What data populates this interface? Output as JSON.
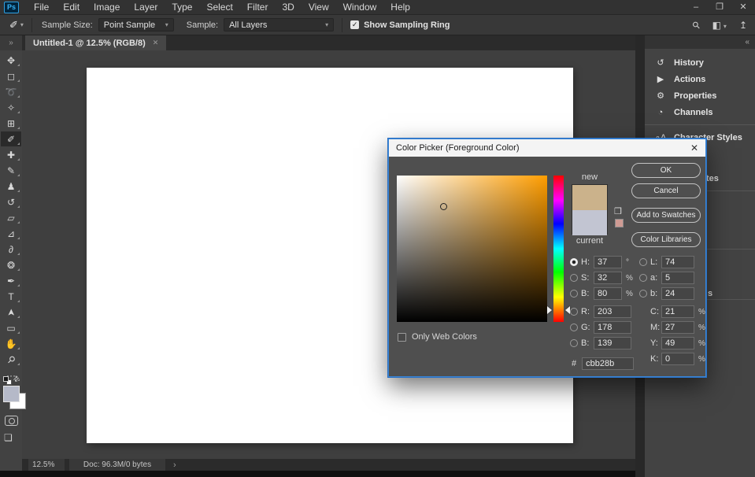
{
  "app": {
    "logo": "Ps"
  },
  "menubar": {
    "items": [
      "File",
      "Edit",
      "Image",
      "Layer",
      "Type",
      "Select",
      "Filter",
      "3D",
      "View",
      "Window",
      "Help"
    ]
  },
  "window_controls": {
    "minimize": "–",
    "restore": "❐",
    "close": "✕"
  },
  "icons": {
    "check": "✓",
    "chevron_down": "▾",
    "search": "⚲",
    "workspace": "◧",
    "share": "↥",
    "collapse_left": "«",
    "collapse_right": "»",
    "eyedropper": "✐",
    "swap_colors": "⇄",
    "screen_mode": "❏",
    "cube": "❒",
    "status_chevron": "›",
    "dialog_close": "✕"
  },
  "options_bar": {
    "sample_size_label": "Sample Size:",
    "sample_size_value": "Point Sample",
    "sample_label": "Sample:",
    "sample_value": "All Layers",
    "show_sampling_ring_label": "Show Sampling Ring",
    "show_sampling_ring_checked": true
  },
  "tab": {
    "title": "Untitled-1 @ 12.5% (RGB/8)",
    "close": "✕"
  },
  "toolbar": {
    "foreground_color": "#b5b9c8",
    "background_color": "#ffffff",
    "tools": [
      {
        "name": "move-tool",
        "glyph": "✥"
      },
      {
        "name": "rectangular-marquee-tool",
        "glyph": "◻"
      },
      {
        "name": "lasso-tool",
        "glyph": "➰"
      },
      {
        "name": "quick-selection-tool",
        "glyph": "✧"
      },
      {
        "name": "crop-tool",
        "glyph": "⊞"
      },
      {
        "name": "eyedropper-tool",
        "glyph": "✐",
        "active": true
      },
      {
        "name": "spot-healing-brush-tool",
        "glyph": "✚"
      },
      {
        "name": "brush-tool",
        "glyph": "✎"
      },
      {
        "name": "clone-stamp-tool",
        "glyph": "♟"
      },
      {
        "name": "history-brush-tool",
        "glyph": "↺"
      },
      {
        "name": "eraser-tool",
        "glyph": "▱"
      },
      {
        "name": "paint-bucket-tool",
        "glyph": "⊿"
      },
      {
        "name": "smudge-tool",
        "glyph": "∂"
      },
      {
        "name": "dodge-tool",
        "glyph": "❂"
      },
      {
        "name": "pen-tool",
        "glyph": "✒"
      },
      {
        "name": "type-tool",
        "glyph": "T"
      },
      {
        "name": "path-selection-tool",
        "glyph": "➤"
      },
      {
        "name": "rectangle-tool",
        "glyph": "▭"
      },
      {
        "name": "hand-tool",
        "glyph": "✋"
      },
      {
        "name": "zoom-tool",
        "glyph": "⚲"
      },
      {
        "name": "more-tools",
        "glyph": "···"
      }
    ]
  },
  "panels": {
    "items": [
      {
        "name": "history",
        "label": "History",
        "glyph": "↺"
      },
      {
        "name": "actions",
        "label": "Actions",
        "glyph": "▶"
      },
      {
        "name": "properties",
        "label": "Properties",
        "glyph": "⚙"
      },
      {
        "name": "channels",
        "label": "Channels",
        "glyph": "◔"
      },
      {
        "name": "character-styles",
        "label": "Character Styles",
        "glyph": "∘A",
        "divider_before": true
      }
    ],
    "fragments": [
      "tes",
      "s"
    ]
  },
  "dialog": {
    "title": "Color Picker (Foreground Color)",
    "new_label": "new",
    "current_label": "current",
    "new_color": "#cbb28b",
    "current_color": "#c2c5d2",
    "warning_swatch_color": "#cf9b94",
    "hue_deg": 37,
    "buttons": [
      "OK",
      "Cancel",
      "Add to Swatches",
      "Color Libraries"
    ],
    "left_fields": [
      {
        "key": "h",
        "label": "H:",
        "value": "37",
        "unit": "°",
        "radio": true,
        "selected": true
      },
      {
        "key": "s",
        "label": "S:",
        "value": "32",
        "unit": "%",
        "radio": true
      },
      {
        "key": "b",
        "label": "B:",
        "value": "80",
        "unit": "%",
        "radio": true
      },
      {
        "key": "r",
        "label": "R:",
        "value": "203",
        "radio": true,
        "gap_before": true
      },
      {
        "key": "g",
        "label": "G:",
        "value": "178",
        "radio": true
      },
      {
        "key": "b2",
        "label": "B:",
        "value": "139",
        "radio": true
      }
    ],
    "right_fields": [
      {
        "key": "l",
        "label": "L:",
        "value": "74",
        "radio": true
      },
      {
        "key": "a",
        "label": "a:",
        "value": "5",
        "radio": true
      },
      {
        "key": "lab-b",
        "label": "b:",
        "value": "24",
        "radio": true
      },
      {
        "key": "c",
        "label": "C:",
        "value": "21",
        "unit": "%",
        "gap_before": true
      },
      {
        "key": "m",
        "label": "M:",
        "value": "27",
        "unit": "%"
      },
      {
        "key": "y",
        "label": "Y:",
        "value": "49",
        "unit": "%"
      },
      {
        "key": "k",
        "label": "K:",
        "value": "0",
        "unit": "%"
      }
    ],
    "hex_label": "#",
    "hex_value": "cbb28b",
    "only_web_colors_label": "Only Web Colors",
    "only_web_colors_checked": false
  },
  "status_bar": {
    "zoom": "12.5%",
    "doc": "Doc: 96.3M/0 bytes"
  }
}
